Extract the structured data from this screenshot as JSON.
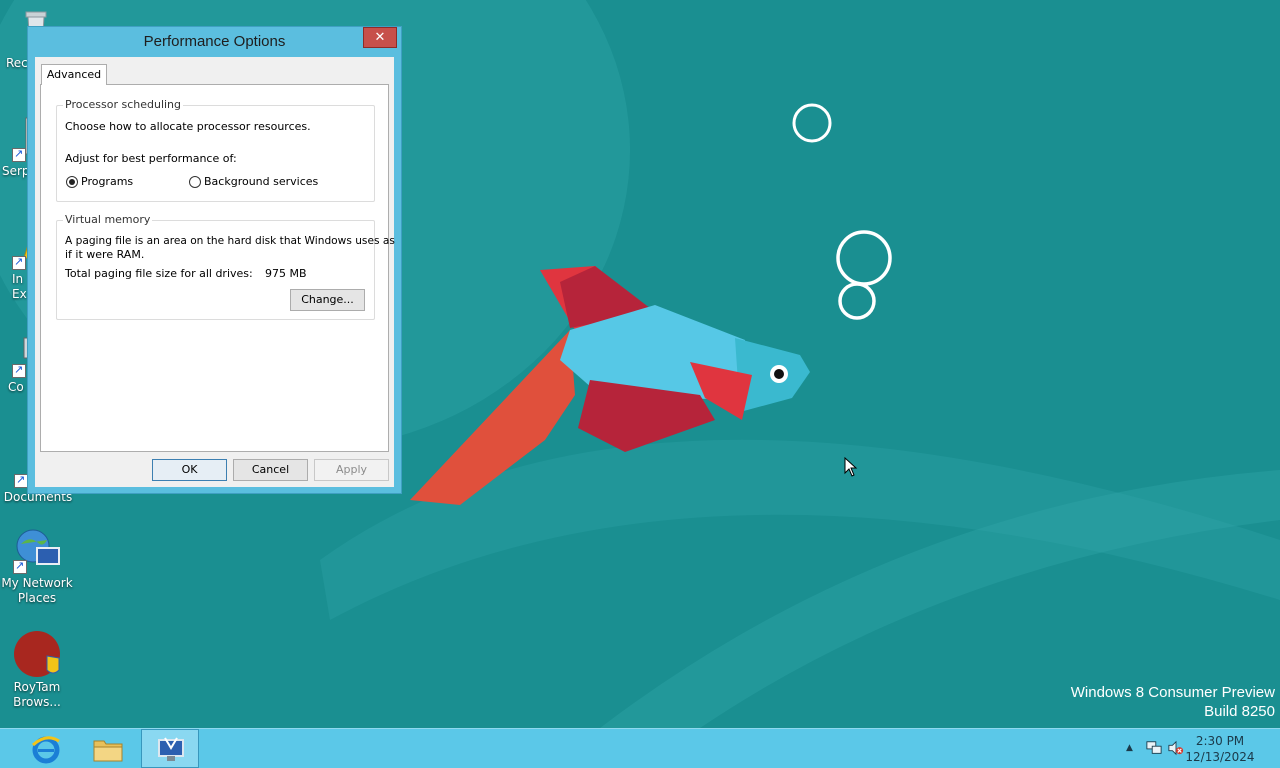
{
  "desktop": {
    "icons": [
      {
        "label": "Rec",
        "icon": "recycle-bin-icon"
      },
      {
        "label": "Serp",
        "icon": "serpent-shortcut-icon"
      },
      {
        "label": "In Ex",
        "icon": "internet-explorer-shortcut-icon"
      },
      {
        "label": "Co",
        "icon": "computer-shortcut-icon"
      },
      {
        "label": "Documents",
        "icon": "documents-shortcut-icon"
      },
      {
        "label": "My Network Places",
        "icon": "network-places-icon"
      },
      {
        "label": "RoyTam Brows...",
        "icon": "roytam-browser-icon"
      }
    ],
    "watermark": {
      "line1": "Windows 8 Consumer Preview",
      "line2": "Build 8250"
    }
  },
  "dialog": {
    "title": "Performance Options",
    "close_symbol": "✕",
    "tab_label": "Advanced",
    "processor": {
      "group_title": "Processor scheduling",
      "description": "Choose how to allocate processor resources.",
      "adjust_label": "Adjust for best performance of:",
      "option_programs": "Programs",
      "option_background": "Background services",
      "selected": "Programs"
    },
    "virtual_memory": {
      "group_title": "Virtual memory",
      "description_line1": "A paging file is an area on the hard disk that Windows uses as",
      "description_line2": "if it were RAM.",
      "total_label": "Total paging file size for all drives:",
      "total_value": "975 MB",
      "change_button": "Change..."
    },
    "buttons": {
      "ok": "OK",
      "cancel": "Cancel",
      "apply": "Apply"
    }
  },
  "taskbar": {
    "pinned": [
      {
        "icon": "internet-explorer-icon"
      },
      {
        "icon": "file-explorer-icon"
      },
      {
        "icon": "system-properties-icon",
        "active": true
      }
    ],
    "clock": {
      "time": "2:30 PM",
      "date": "12/13/2024"
    }
  },
  "colors": {
    "desktop_bg": "#1a8f91",
    "taskbar": "#5bc8e8",
    "window_frame": "#5bbedf",
    "close_button": "#c7504b"
  }
}
